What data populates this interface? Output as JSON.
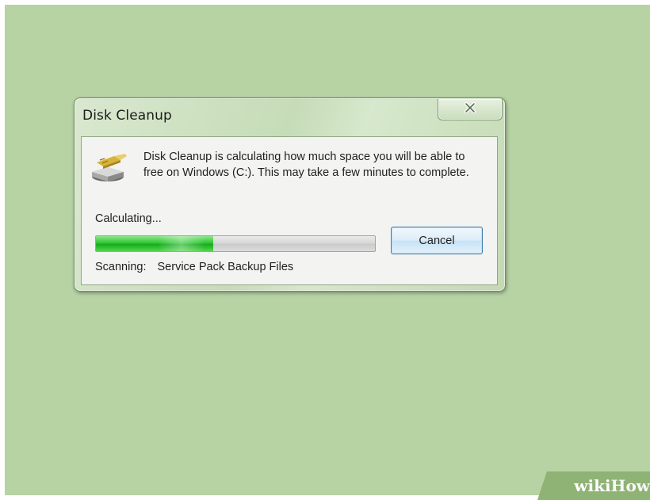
{
  "dialog": {
    "title": "Disk Cleanup",
    "close_icon": "close-x-icon",
    "drive_icon": "disk-cleanup-drive-icon",
    "message": "Disk Cleanup is calculating how much space you will be able to free on Windows (C:). This may take a few minutes to complete.",
    "status_label": "Calculating...",
    "progress": 0.42,
    "cancel_label": "Cancel",
    "scanning_label": "Scanning:",
    "scanning_item": "Service Pack Backup Files"
  },
  "watermark": {
    "part1": "wiki",
    "part2": "How"
  },
  "colors": {
    "desktop_background": "#b7d3a4",
    "progress_fill": "#16ad1c",
    "button_border": "#3c7fb1"
  }
}
